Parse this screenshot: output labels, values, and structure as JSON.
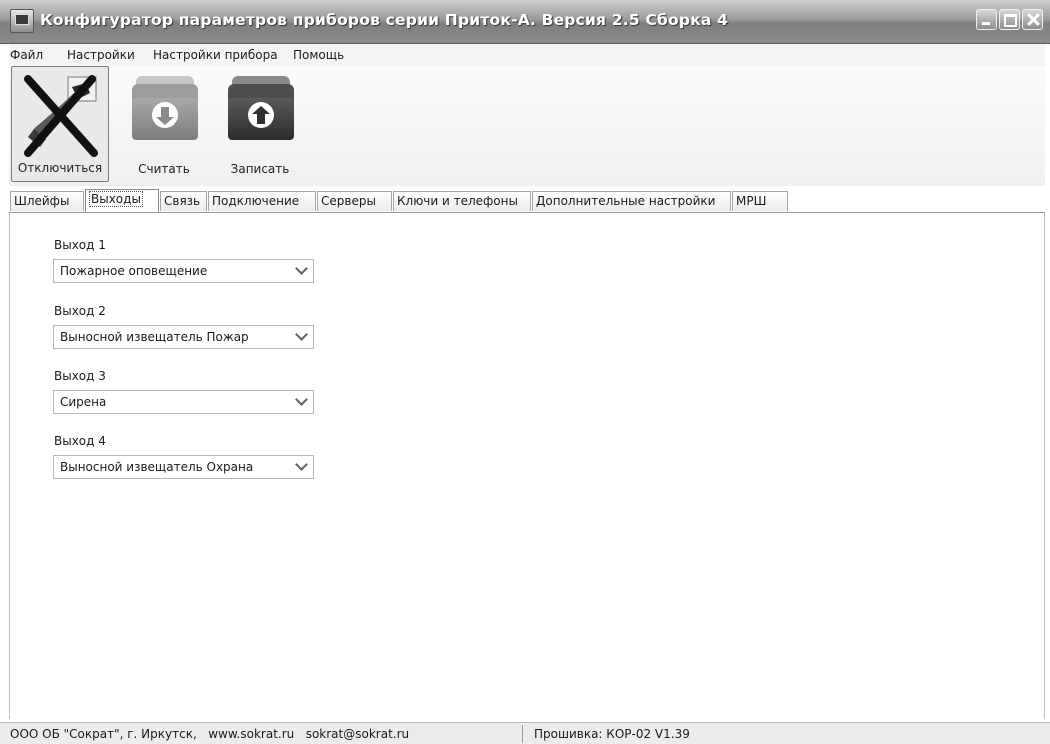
{
  "window": {
    "title": "Конфигуратор параметров приборов серии Приток-А. Версия 2.5 Сборка 4"
  },
  "menu": {
    "items": [
      {
        "label": "Файл"
      },
      {
        "label": "Настройки"
      },
      {
        "label": "Настройки прибора"
      },
      {
        "label": "Помощь"
      }
    ]
  },
  "toolbar": {
    "disconnect_label": "Отключиться",
    "read_label": "Считать",
    "write_label": "Записать"
  },
  "tabs": [
    {
      "label": "Шлейфы",
      "active": false
    },
    {
      "label": "Выходы",
      "active": true
    },
    {
      "label": "Связь",
      "active": false
    },
    {
      "label": "Подключение",
      "active": false
    },
    {
      "label": "Серверы",
      "active": false
    },
    {
      "label": "Ключи и телефоны",
      "active": false
    },
    {
      "label": "Дополнительные настройки",
      "active": false
    },
    {
      "label": "МРШ",
      "active": false
    }
  ],
  "outputs": [
    {
      "label": "Выход 1",
      "value": "Пожарное оповещение"
    },
    {
      "label": "Выход 2",
      "value": "Выносной извещатель Пожар"
    },
    {
      "label": "Выход 3",
      "value": "Сирена"
    },
    {
      "label": "Выход 4",
      "value": "Выносной извещатель Охрана"
    }
  ],
  "statusbar": {
    "company": "ООО ОБ \"Сократ\", г. Иркутск,   www.sokrat.ru   sokrat@sokrat.ru",
    "firmware": "Прошивка: КОР-02 V1.39"
  }
}
